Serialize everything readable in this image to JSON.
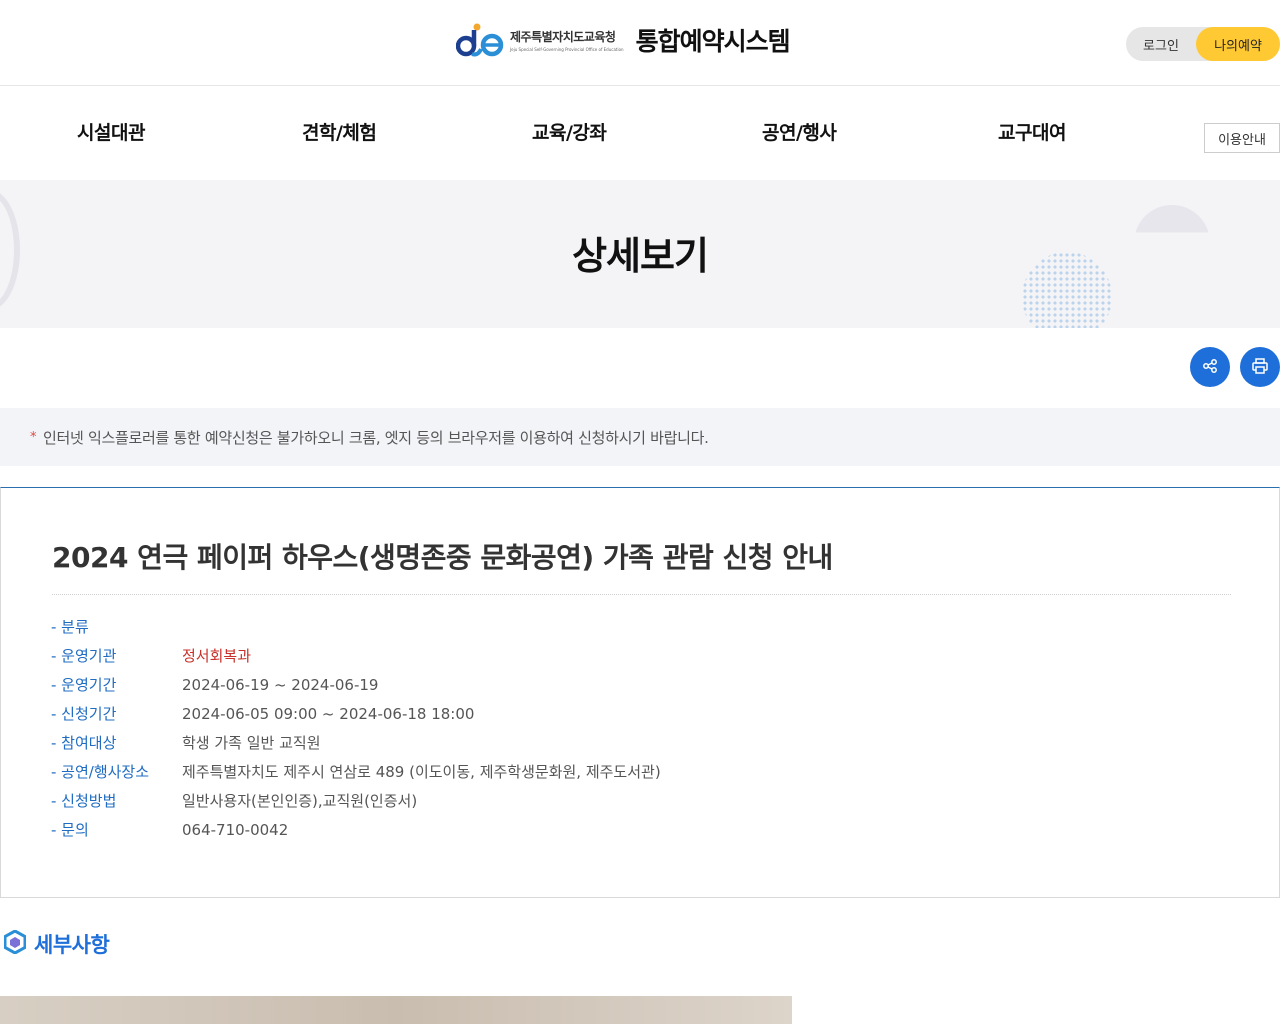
{
  "header": {
    "org_name_ko": "제주특별자치도교육청",
    "org_name_en": "Jeju Special Self-Governing Provincial Office of Education",
    "system_title": "통합예약시스템",
    "login_label": "로그인",
    "my_reservation_label": "나의예약"
  },
  "nav": {
    "items": [
      {
        "label": "시설대관"
      },
      {
        "label": "견학/체험"
      },
      {
        "label": "교육/강좌"
      },
      {
        "label": "공연/행사"
      },
      {
        "label": "교구대여"
      }
    ],
    "guide_label": "이용안내"
  },
  "banner": {
    "title": "상세보기"
  },
  "actions": {
    "share_icon": "share-icon",
    "print_icon": "print-icon"
  },
  "notice": {
    "star": "*",
    "text": "인터넷 익스플로러를 통한 예약신청은 불가하오니 크롬, 엣지 등의 브라우저를 이용하여 신청하시기 바랍니다."
  },
  "detail": {
    "title": "2024 연극 페이퍼 하우스(생명존중 문화공연) 가족 관람 신청 안내",
    "info": [
      {
        "label": "- 분류",
        "value": ""
      },
      {
        "label": "- 운영기관",
        "value": "정서회복과"
      },
      {
        "label": "- 운영기간",
        "value": "2024-06-19 ~ 2024-06-19"
      },
      {
        "label": "- 신청기간",
        "value": "2024-06-05 09:00 ~ 2024-06-18 18:00"
      },
      {
        "label": "- 참여대상",
        "value": "학생 가족 일반 교직원"
      },
      {
        "label": "- 공연/행사장소",
        "value": "제주특별자치도 제주시 연삼로 489 (이도이동, 제주학생문화원, 제주도서관)"
      },
      {
        "label": "- 신청방법",
        "value": "일반사용자(본인인증),교직원(인증서)"
      },
      {
        "label": "- 문의",
        "value": "064-710-0042"
      }
    ]
  },
  "section": {
    "title": "세부사항"
  },
  "colors": {
    "accent_blue": "#1e6fd9",
    "label_blue": "#1f6cc2",
    "highlight_red": "#c8312a",
    "my_reservation_yellow": "#ffc934"
  }
}
